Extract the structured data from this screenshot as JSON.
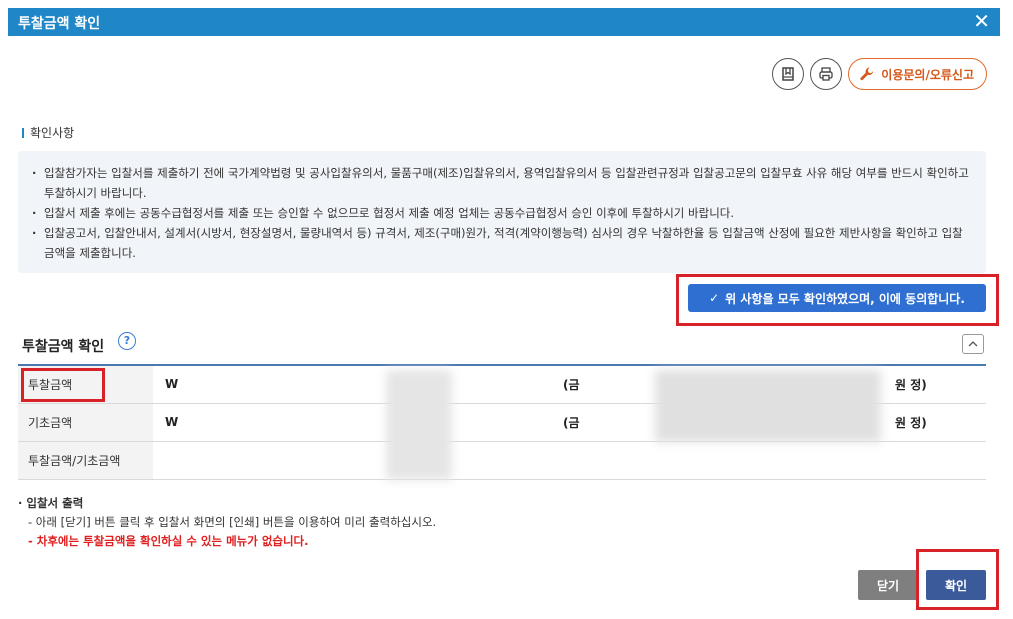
{
  "window": {
    "title": "투찰금액 확인",
    "close_glyph": "✕"
  },
  "toolbar": {
    "bookmark_icon": "bookmark-icon",
    "print_icon": "printer-icon",
    "report_label": "이용문의/오류신고",
    "report_icon": "wrench-icon",
    "accent": "#e06a2a"
  },
  "confirm_section": {
    "label": "확인사항",
    "items": [
      "입찰참가자는 입찰서를 제출하기 전에 국가계약법령 및 공사입찰유의서, 물품구매(제조)입찰유의서, 용역입찰유의서 등 입찰관련규정과 입찰공고문의 입찰무효 사유 해당 여부를 반드시 확인하고 투찰하시기 바랍니다.",
      "입찰서 제출 후에는 공동수급협정서를 제출 또는 승인할 수 없으므로 협정서 제출 예정 업체는 공동수급협정서 승인 이후에 투찰하시기 바랍니다.",
      "입찰공고서, 입찰안내서, 설계서(시방서, 현장설명서, 물량내역서 등) 규격서, 제조(구매)원가, 적격(계약이행능력) 심사의 경우 낙찰하한율 등 입찰금액 산정에 필요한 제반사항을 확인하고 입찰금액을 제출합니다."
    ],
    "agree_label": "위 사항을 모두 확인하였으며, 이에 동의합니다.",
    "agree_check": "✓"
  },
  "amount": {
    "title": "투찰금액 확인",
    "help": "?",
    "collapse_glyph": "︿",
    "rows": [
      {
        "label": "투찰금액",
        "currency": "W",
        "geum": "(금",
        "tail": "원 정)"
      },
      {
        "label": "기초금액",
        "currency": "W",
        "geum": "(금",
        "tail": "원 정)"
      },
      {
        "label": "투찰금액/기초금액",
        "currency": "",
        "geum": "",
        "tail": ""
      }
    ]
  },
  "print_notes": {
    "title": "입찰서 출력",
    "line1": "- 아래 [닫기] 버튼 클릭 후 입찰서 화면의 [인쇄] 버튼을 이용하여 미리 출력하십시오.",
    "line2": "- 차후에는 투찰금액을 확인하실 수 있는 메뉴가 없습니다."
  },
  "footer": {
    "close_label": "닫기",
    "confirm_label": "확인"
  },
  "colors": {
    "titlebar": "#1f86c8",
    "agree": "#2f6fd1",
    "confirm": "#3b5a9a",
    "highlight": "#d8222a"
  }
}
